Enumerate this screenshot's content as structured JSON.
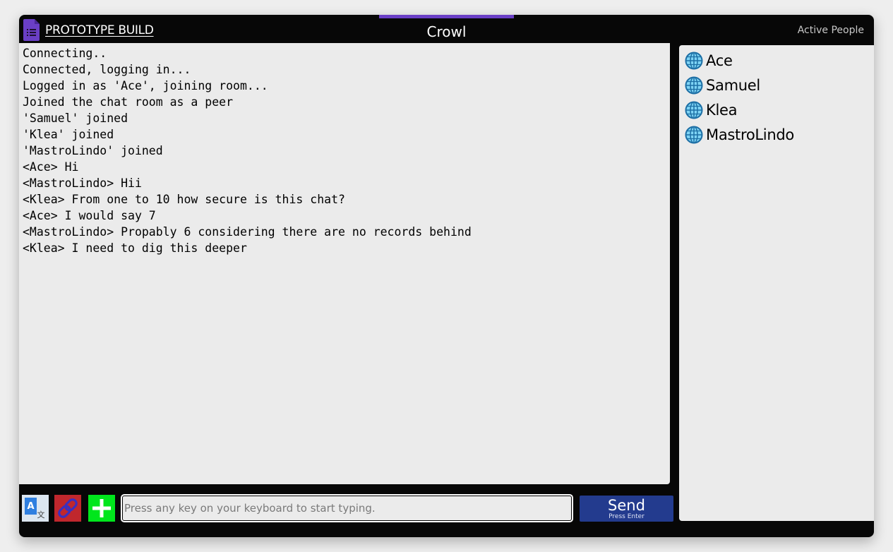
{
  "header": {
    "build_label": "PROTOTYPE BUILD",
    "title": "Crowl",
    "active_people_label": "Active People",
    "logo_icon": "document-list-icon",
    "accent_color": "#6a3fc6"
  },
  "chat": {
    "lines": [
      "Connecting..",
      "Connected, logging in...",
      "Logged in as 'Ace', joining room...",
      "Joined the chat room as a peer",
      "'Samuel' joined",
      "'Klea' joined",
      "'MastroLindo' joined",
      "<Ace> Hi",
      "<MastroLindo> Hii",
      "<Klea> From one to 10 how secure is this chat?",
      "<Ace> I would say 7",
      "<MastroLindo> Propably 6 considering there are no records behind",
      "<Klea> I need to dig this deeper"
    ]
  },
  "people": {
    "icon": "globe-icon",
    "list": [
      "Ace",
      "Samuel",
      "Klea",
      "MastroLindo"
    ]
  },
  "toolbar": {
    "translate_icon": "translate-icon",
    "link_icon": "link-icon",
    "add_icon": "plus-icon",
    "input_placeholder": "Press any key on your keyboard to start typing.",
    "input_value": "",
    "send_label": "Send",
    "send_hint": "Press Enter",
    "send_color": "#233b8e"
  }
}
